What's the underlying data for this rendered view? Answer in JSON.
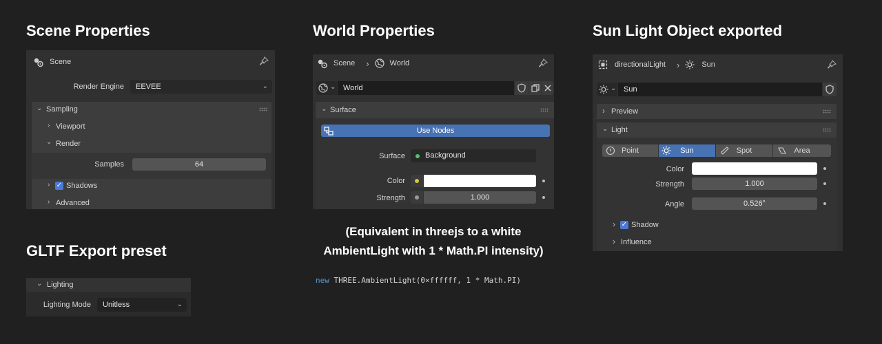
{
  "headings": {
    "scene": "Scene Properties",
    "world": "World Properties",
    "sun": "Sun Light Object exported",
    "gltf": "GLTF Export preset"
  },
  "scene_panel": {
    "header": "Scene",
    "render_engine_label": "Render Engine",
    "render_engine_value": "EEVEE",
    "sampling": "Sampling",
    "viewport": "Viewport",
    "render": "Render",
    "samples_label": "Samples",
    "samples_value": "64",
    "shadows": "Shadows",
    "advanced": "Advanced"
  },
  "gltf_panel": {
    "lighting": "Lighting",
    "lighting_mode_label": "Lighting Mode",
    "lighting_mode_value": "Unitless"
  },
  "world_panel": {
    "breadcrumb_scene": "Scene",
    "breadcrumb_world": "World",
    "world_name": "World",
    "surface_section": "Surface",
    "use_nodes": "Use Nodes",
    "surface_label": "Surface",
    "surface_value": "Background",
    "color_label": "Color",
    "strength_label": "Strength",
    "strength_value": "1.000"
  },
  "caption": {
    "line1": "(Equivalent in threejs to a white",
    "line2": "AmbientLight with 1 * Math.PI intensity)"
  },
  "code": {
    "keyword": "new",
    "body": " THREE.AmbientLight(0×ffffff, 1 * Math.PI)"
  },
  "sun_panel": {
    "breadcrumb_object": "directionalLight",
    "breadcrumb_light": "Sun",
    "light_name": "Sun",
    "preview": "Preview",
    "light_section": "Light",
    "types": [
      "Point",
      "Sun",
      "Spot",
      "Area"
    ],
    "active_type": "Sun",
    "color_label": "Color",
    "strength_label": "Strength",
    "strength_value": "1.000",
    "angle_label": "Angle",
    "angle_value": "0.526°",
    "shadow": "Shadow",
    "influence": "Influence"
  },
  "colors": {
    "accent": "#4772b3",
    "white_swatch": "#ffffff",
    "surface_dot": "#55c26b",
    "color_dot": "#d4c73b",
    "strength_dot": "#9a9a9a"
  }
}
